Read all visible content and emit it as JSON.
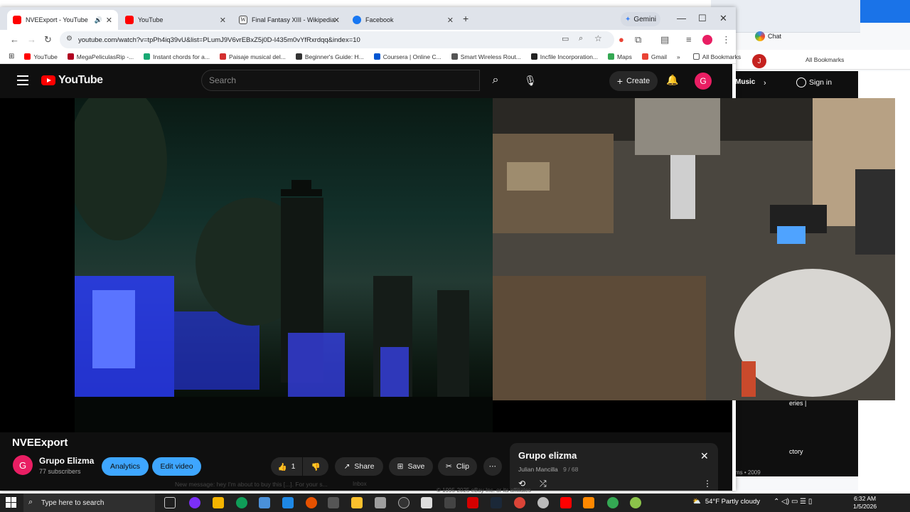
{
  "browser": {
    "tabs": [
      {
        "label": "NVEExport - YouTube",
        "icon": "youtube-icon",
        "active": true
      },
      {
        "label": "YouTube",
        "icon": "youtube-icon",
        "active": false
      },
      {
        "label": "Final Fantasy XIII - Wikipedia",
        "icon": "wikipedia-icon",
        "active": false
      },
      {
        "label": "Facebook",
        "icon": "facebook-icon",
        "active": false
      }
    ],
    "gemini_label": "Gemini",
    "url": "youtube.com/watch?v=tpPh4iq39vU&list=PLumJ9V6vrEBxZ5j0D-I435m0vYfRxrdqq&index=10",
    "bookmarks": [
      {
        "label": "YouTube",
        "color": "#ff0000"
      },
      {
        "label": "MegaPeliculasRip -...",
        "color": "#b00020"
      },
      {
        "label": "Instant chords for a...",
        "color": "#19a974"
      },
      {
        "label": "Paisaje musical del...",
        "color": "#d32f2f"
      },
      {
        "label": "Beginner's Guide: H...",
        "color": "#333333"
      },
      {
        "label": "Coursera | Online C...",
        "color": "#0056d2"
      },
      {
        "label": "Smart Wireless Rout...",
        "color": "#555555"
      },
      {
        "label": "Incfile Incorporation...",
        "color": "#222222"
      },
      {
        "label": "Maps",
        "color": "#34a853"
      },
      {
        "label": "Gmail",
        "color": "#ea4335"
      }
    ],
    "all_bookmarks": "All Bookmarks"
  },
  "youtube": {
    "logo_text": "YouTube",
    "search_placeholder": "Search",
    "create_label": "Create",
    "avatar_letter": "G",
    "video_title": "NVEExport",
    "channel_name": "Grupo Elizma",
    "subscribers": "77 subscribers",
    "analytics_label": "Analytics",
    "edit_label": "Edit video",
    "like_count": "1",
    "share_label": "Share",
    "save_label": "Save",
    "clip_label": "Clip",
    "playlist": {
      "title": "Grupo elizma",
      "owner": "Julian Mancilla",
      "position": "9 / 68"
    }
  },
  "background_window": {
    "chat_label": "Chat",
    "all_bookmarks": "All Bookmarks",
    "avatar_letter": "J",
    "music_label": "Music",
    "signin_label": "Sign in",
    "side_item_1": "eries |",
    "side_item_2": "ctory",
    "footer_year": "ms • 2009"
  },
  "notifications": {
    "gmail_message": "New message: hey I'm about to buy this [...]. For your s...",
    "gmail_inbox": "Inbox",
    "ebay_footer": "© 1995-2025 eBay Inc. or its affiliates"
  },
  "taskbar": {
    "search_placeholder": "Type here to search",
    "weather": "54°F  Partly cloudy",
    "time": "6:32 AM",
    "date": "1/5/2026"
  },
  "colors": {
    "youtube_red": "#ff0000",
    "accent_blue": "#3ea6ff",
    "dark_bg": "#0f0f0f",
    "taskbar": "#202020"
  }
}
